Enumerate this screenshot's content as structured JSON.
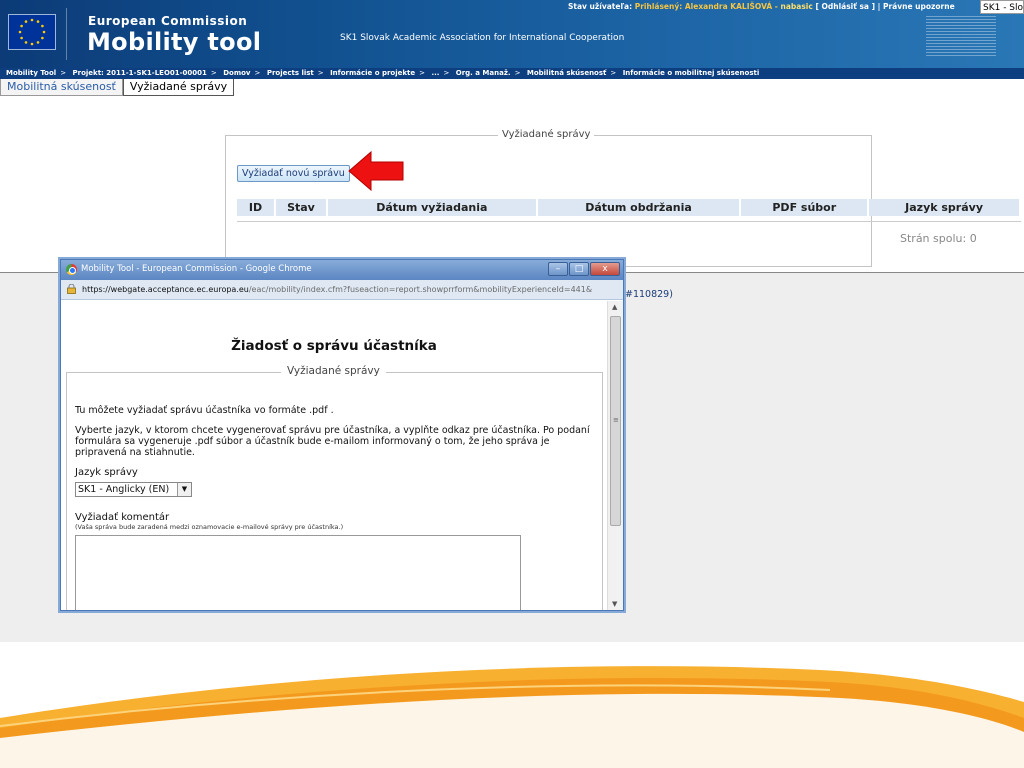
{
  "header": {
    "ec_name": "European Commission",
    "app_name": "Mobility tool",
    "organisation": "SK1 Slovak Academic Association for International Cooperation",
    "status_label": "Stav užívateľa:",
    "logged_in": "Prihlásený: Alexandra KALIŠOVÁ -",
    "nick": "nabasic",
    "logout": "[ Odhlásiť sa ]",
    "legal": "Právne upozorne",
    "corner_tag": "SK1 - Slo"
  },
  "breadcrumb": [
    "Mobility Tool",
    "Projekt: 2011-1-SK1-LEO01-00001",
    "Domov",
    "Projects list",
    "Informácie o projekte",
    "...",
    "Org. a Manaž.",
    "Mobilitná skúsenosť",
    "Informácie o mobilitnej skúsenosti"
  ],
  "tabs": {
    "tab1": "Mobilitná skúsenosť",
    "tab2": "Vyžiadané správy"
  },
  "reports": {
    "legend": "Vyžiadané správy",
    "request_button": "Vyžiadať novú správu",
    "columns": [
      "ID",
      "Stav",
      "Dátum vyžiadania",
      "Dátum obdržania",
      "PDF súbor",
      "Jazyk správy"
    ],
    "pages": "Strán spolu: 0"
  },
  "behind_text": "#110829)",
  "popup": {
    "window_title": "Mobility Tool - European Commission - Google Chrome",
    "url_host": "https://webgate.acceptance.ec.europa.eu",
    "url_path": "/eac/mobility/index.cfm?fuseaction=report.showprrform&mobilityExperienceId=441&",
    "heading": "Žiadosť o správu účastníka",
    "legend": "Vyžiadané správy",
    "intro": "Tu môžete vyžiadať správu účastníka vo formáte .pdf .",
    "instructions": "Vyberte jazyk, v ktorom chcete vygenerovať správu pre účastníka, a vyplňte odkaz pre účastníka. Po podaní formulára sa vygeneruje .pdf súbor a účastník bude e-mailom informovaný o tom, že jeho správa je pripravená na stiahnutie.",
    "language_label": "Jazyk správy",
    "language_value": "SK1 - Anglicky (EN)",
    "comment_label": "Vyžiadať komentár",
    "comment_hint": "(Vaša správa bude zaradená medzi oznamovacie e-mailové správy pre účastníka.)",
    "comment_value": ""
  }
}
